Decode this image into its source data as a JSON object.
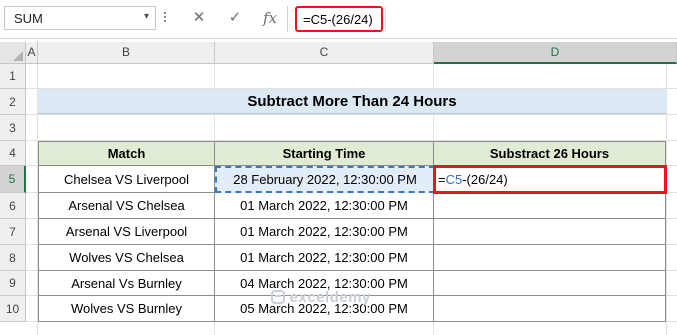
{
  "formula_bar": {
    "name_box": "SUM",
    "name_box_arrow": "▾",
    "cancel_icon": "✕",
    "enter_icon": "✓",
    "fx_label": "fx",
    "formula": "=C5-(26/24)"
  },
  "columns": [
    "A",
    "B",
    "C",
    "D"
  ],
  "rows": [
    "1",
    "2",
    "3",
    "4",
    "5",
    "6",
    "7",
    "8",
    "9",
    "10"
  ],
  "active": {
    "column": "D",
    "row": "5"
  },
  "sheet": {
    "title": "Subtract More Than 24 Hours",
    "headers": [
      "Match",
      "Starting Time",
      "Substract 26 Hours"
    ],
    "matches": [
      "Chelsea VS Liverpool",
      "Arsenal VS Chelsea",
      "Arsenal VS Liverpool",
      "Wolves VS Chelsea",
      "Arsenal Vs Burnley",
      "Wolves VS Burnley"
    ],
    "times": [
      "28 February 2022, 12:30:00 PM",
      "01 March 2022, 12:30:00 PM",
      "01 March 2022, 12:30:00 PM",
      "01 March 2022, 12:30:00 PM",
      "04 March 2022, 12:30:00 PM",
      "05 March 2022, 12:30:00 PM"
    ],
    "edit_cell": {
      "prefix": "=",
      "ref": "C5",
      "suffix": "-(26/24)"
    }
  },
  "watermark": "exceldemy",
  "colors": {
    "accent_green": "#217346",
    "highlight_red": "#e8141e",
    "ref_blue": "#2f6fc4"
  }
}
